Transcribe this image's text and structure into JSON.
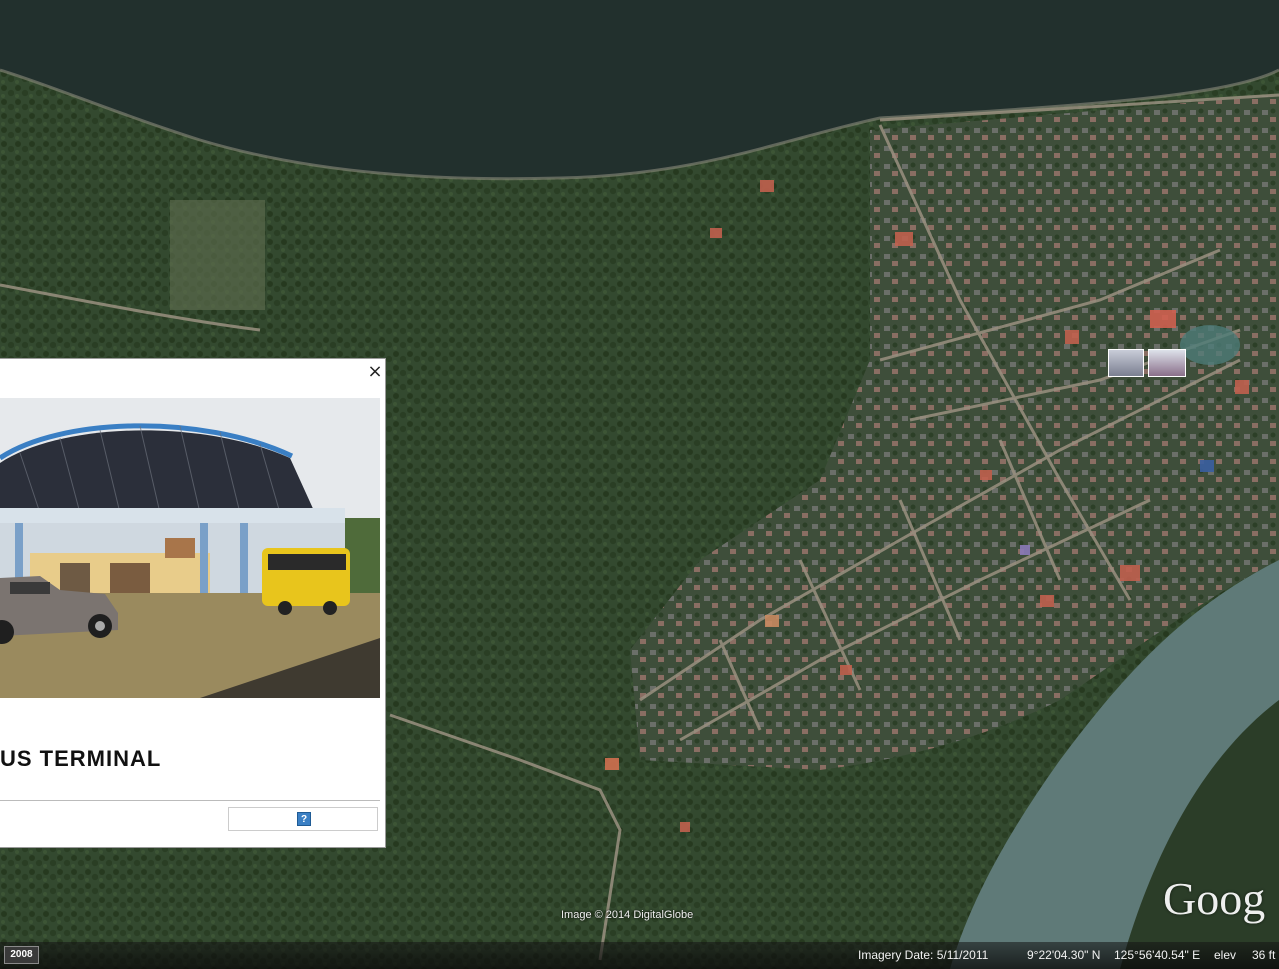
{
  "popup": {
    "close_label": "×",
    "title": "US TERMINAL",
    "help_label": "?"
  },
  "map": {
    "credit": "Image © 2014 DigitalGlobe",
    "logo": "Goog"
  },
  "status_bar": {
    "year": "2008",
    "imagery_date": "Imagery Date: 5/11/2011",
    "latitude": "9°22'04.30\" N",
    "longitude": "125°56'40.54\" E",
    "elev_label": "elev",
    "elev_value": "36 ft"
  },
  "colors": {
    "sea": "#22302d",
    "land": "#36503a",
    "river": "#5f7a78",
    "road": "#9a9080",
    "roof_red": "#c0604e"
  }
}
